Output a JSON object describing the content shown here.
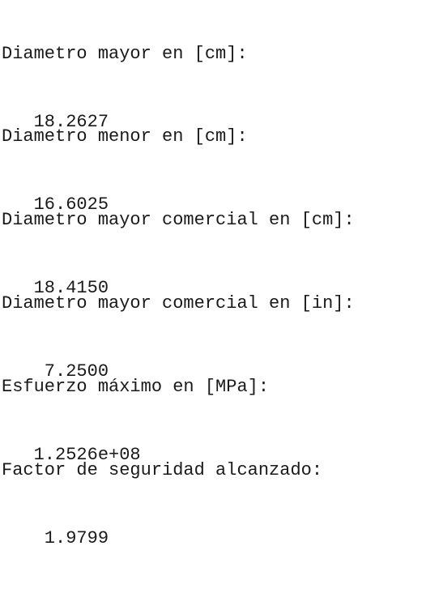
{
  "output": {
    "lines": [
      {
        "label": "Diametro mayor en [cm]:",
        "value": "   18.2627"
      },
      {
        "label": "Diametro menor en [cm]:",
        "value": "   16.6025"
      },
      {
        "label": "Diametro mayor comercial en [cm]:",
        "value": "   18.4150"
      },
      {
        "label": "Diametro mayor comercial en [in]:",
        "value": "    7.2500"
      },
      {
        "label": "Esfuerzo máximo en [MPa]:",
        "value": "   1.2526e+08"
      },
      {
        "label": "Factor de seguridad alcanzado:",
        "value": "    1.9799"
      }
    ]
  }
}
